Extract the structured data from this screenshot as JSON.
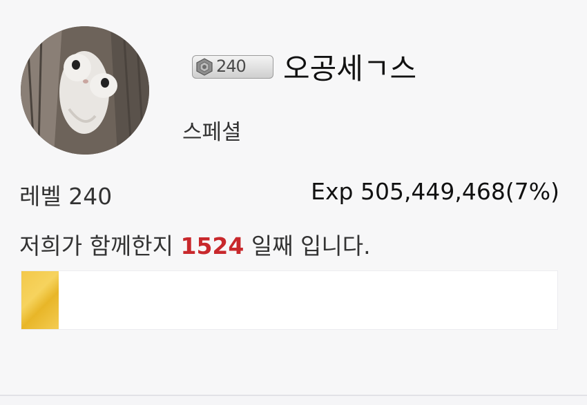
{
  "profile": {
    "badge_number": "240",
    "badge_icon": "level-emblem-icon",
    "nickname": "오공세ㄱ스",
    "job": "스페셜",
    "level_label": "레벨 240",
    "exp_label": "Exp 505,449,468(7%)",
    "exp_percent": 7,
    "days_prefix": "저희가 함께한지 ",
    "days_count": "1524",
    "days_suffix": " 일째 입니다."
  },
  "colors": {
    "background": "#f7f7f8",
    "days_highlight": "#c8282c",
    "exp_fill": "#f3c84a"
  }
}
